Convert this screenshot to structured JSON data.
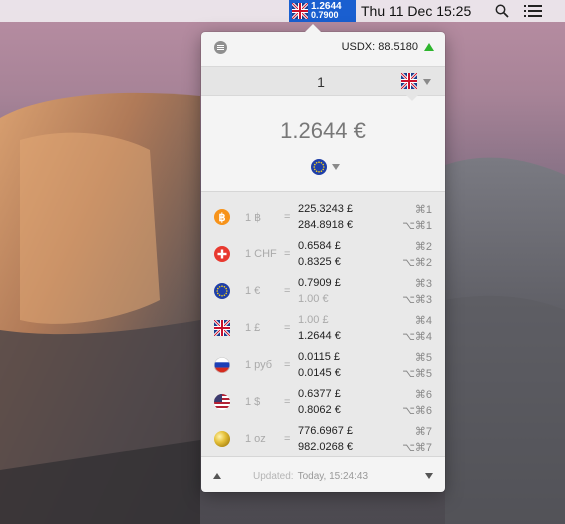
{
  "menubar": {
    "status_rate_primary": "1.2644",
    "status_rate_secondary": "0.7900",
    "clock": "Thu 11 Dec  15:25",
    "icons": [
      "gb-flag-icon",
      "search-icon",
      "list-icon"
    ]
  },
  "popover": {
    "usdx": "USDX: 88.5180",
    "usdx_trend": "up",
    "amount_value": "1",
    "source_currency_icon": "gb-flag-icon",
    "result": "1.2644 €",
    "target_currency_icon": "eu-flag-icon",
    "rates": [
      {
        "icon": "bitcoin-icon",
        "base": "1 ฿",
        "eq": "=",
        "v1": "225.3243 £",
        "v2": "284.8918 €",
        "k1": "⌘1",
        "k2": "⌥⌘1",
        "v1_dim": false,
        "v2_dim": false
      },
      {
        "icon": "ch-flag-icon",
        "base": "1 CHF",
        "eq": "=",
        "v1": "0.6584 £",
        "v2": "0.8325 €",
        "k1": "⌘2",
        "k2": "⌥⌘2",
        "v1_dim": false,
        "v2_dim": false
      },
      {
        "icon": "eu-flag-icon",
        "base": "1 €",
        "eq": "=",
        "v1": "0.7909 £",
        "v2": "1.00 €",
        "k1": "⌘3",
        "k2": "⌥⌘3",
        "v1_dim": false,
        "v2_dim": true
      },
      {
        "icon": "gb-flag-icon",
        "base": "1 £",
        "eq": "=",
        "v1": "1.00 £",
        "v2": "1.2644 €",
        "k1": "⌘4",
        "k2": "⌥⌘4",
        "v1_dim": true,
        "v2_dim": false
      },
      {
        "icon": "ru-flag-icon",
        "base": "1 руб",
        "eq": "=",
        "v1": "0.0115 £",
        "v2": "0.0145 €",
        "k1": "⌘5",
        "k2": "⌥⌘5",
        "v1_dim": false,
        "v2_dim": false
      },
      {
        "icon": "us-flag-icon",
        "base": "1 $",
        "eq": "=",
        "v1": "0.6377 £",
        "v2": "0.8062 €",
        "k1": "⌘6",
        "k2": "⌥⌘6",
        "v1_dim": false,
        "v2_dim": false
      },
      {
        "icon": "gold-icon",
        "base": "1 oz",
        "eq": "=",
        "v1": "776.6967 £",
        "v2": "982.0268 €",
        "k1": "⌘7",
        "k2": "⌥⌘7",
        "v1_dim": false,
        "v2_dim": false
      }
    ],
    "footer": {
      "label": "Updated:",
      "time": "Today, 15:24:43"
    }
  },
  "colors": {
    "status_bg": "#1a5fd0",
    "trend_up": "#2eb52e",
    "bitcoin": "#f7931a",
    "swiss": "#e8392f",
    "eu": "#1f3fa8",
    "gold": "#e6c23c"
  }
}
